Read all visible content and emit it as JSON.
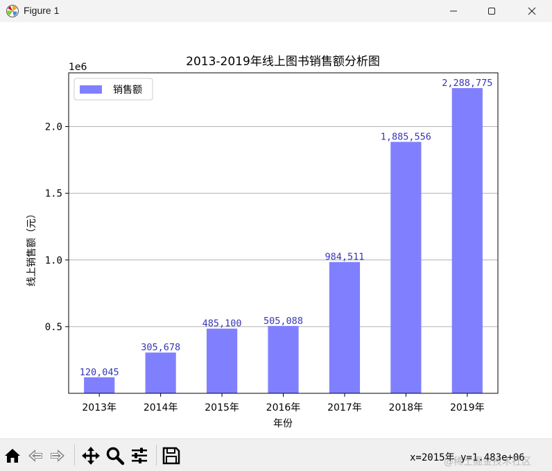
{
  "window": {
    "title": "Figure 1",
    "icon": "matplotlib-icon",
    "controls": [
      "minimize-icon",
      "maximize-icon",
      "close-icon"
    ]
  },
  "toolbar": {
    "buttons": [
      "home-icon",
      "back-arrow-icon",
      "forward-arrow-icon",
      "pan-icon",
      "zoom-icon",
      "subplots-config-icon",
      "save-icon"
    ],
    "coords": "x=2015年 y=1.483e+06"
  },
  "watermark": "@稀土掘金技术社区",
  "chart_data": {
    "type": "bar",
    "title": "2013-2019年线上图书销售额分析图",
    "xlabel": "年份",
    "ylabel": "线上销售额（元）",
    "scale_label": "1e6",
    "categories": [
      "2013年",
      "2014年",
      "2015年",
      "2016年",
      "2017年",
      "2018年",
      "2019年"
    ],
    "series": [
      {
        "name": "销售额",
        "values": [
          120045,
          305678,
          485100,
          505088,
          984511,
          1885556,
          2288775
        ]
      }
    ],
    "data_labels": [
      "120,045",
      "305,678",
      "485,100",
      "505,088",
      "984,511",
      "1,885,556",
      "2,288,775"
    ],
    "yticks": [
      0.5,
      1.0,
      1.5,
      2.0
    ],
    "ytick_labels": [
      "0.5",
      "1.0",
      "1.5",
      "2.0"
    ],
    "ylim": [
      0,
      2403214
    ],
    "grid": "y",
    "legend": "upper-left",
    "colors": {
      "bar": "#8080ff",
      "data_label": "#3535b8",
      "grid": "#b0b0b0"
    }
  }
}
